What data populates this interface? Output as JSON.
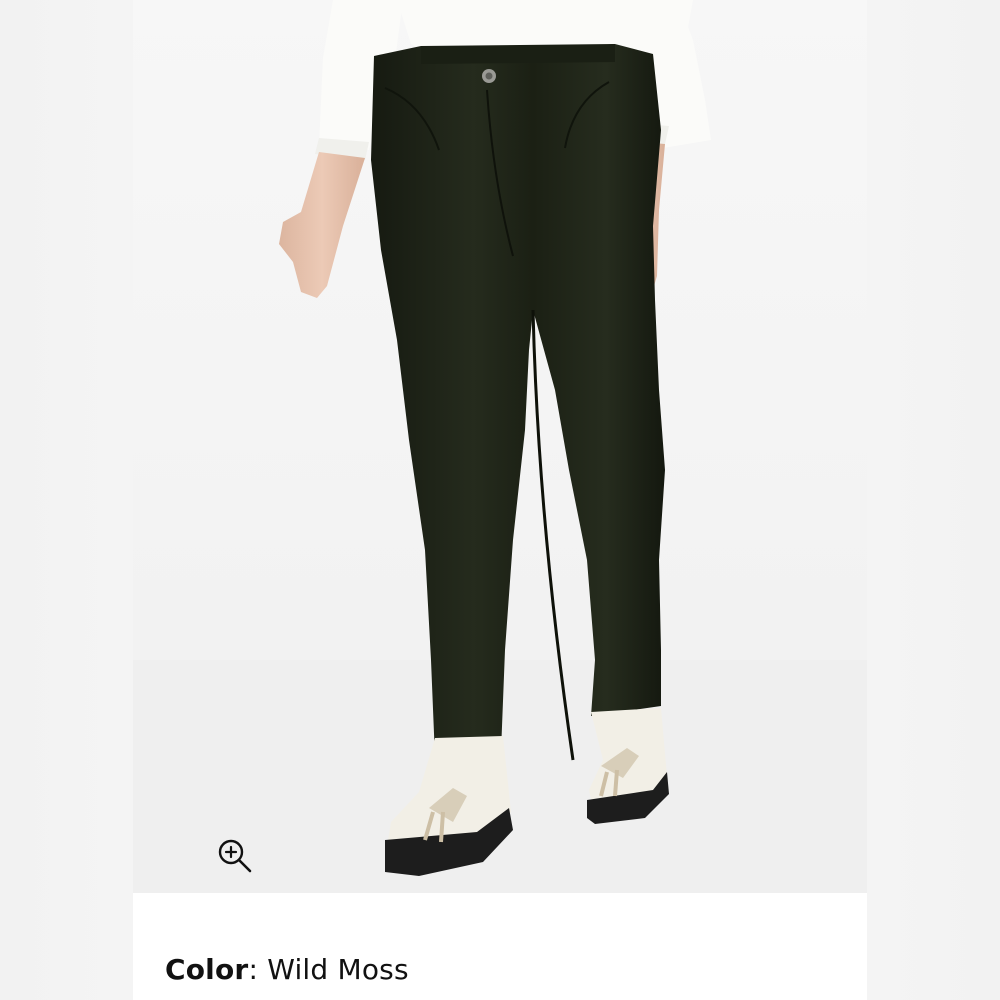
{
  "product": {
    "image_alt": "Model wearing dark green corduroy skinny pants with white sweater and white tassel loafers",
    "colors": {
      "pants": "#1f2418",
      "sweater": "#fbfbf9",
      "loafer": "#f2efe6",
      "sole": "#1d1d1d",
      "skin": "#e7c6b2"
    },
    "zoom": {
      "icon": "zoom-in-icon"
    },
    "color": {
      "label": "Color",
      "separator": ":",
      "value": "Wild Moss"
    }
  }
}
